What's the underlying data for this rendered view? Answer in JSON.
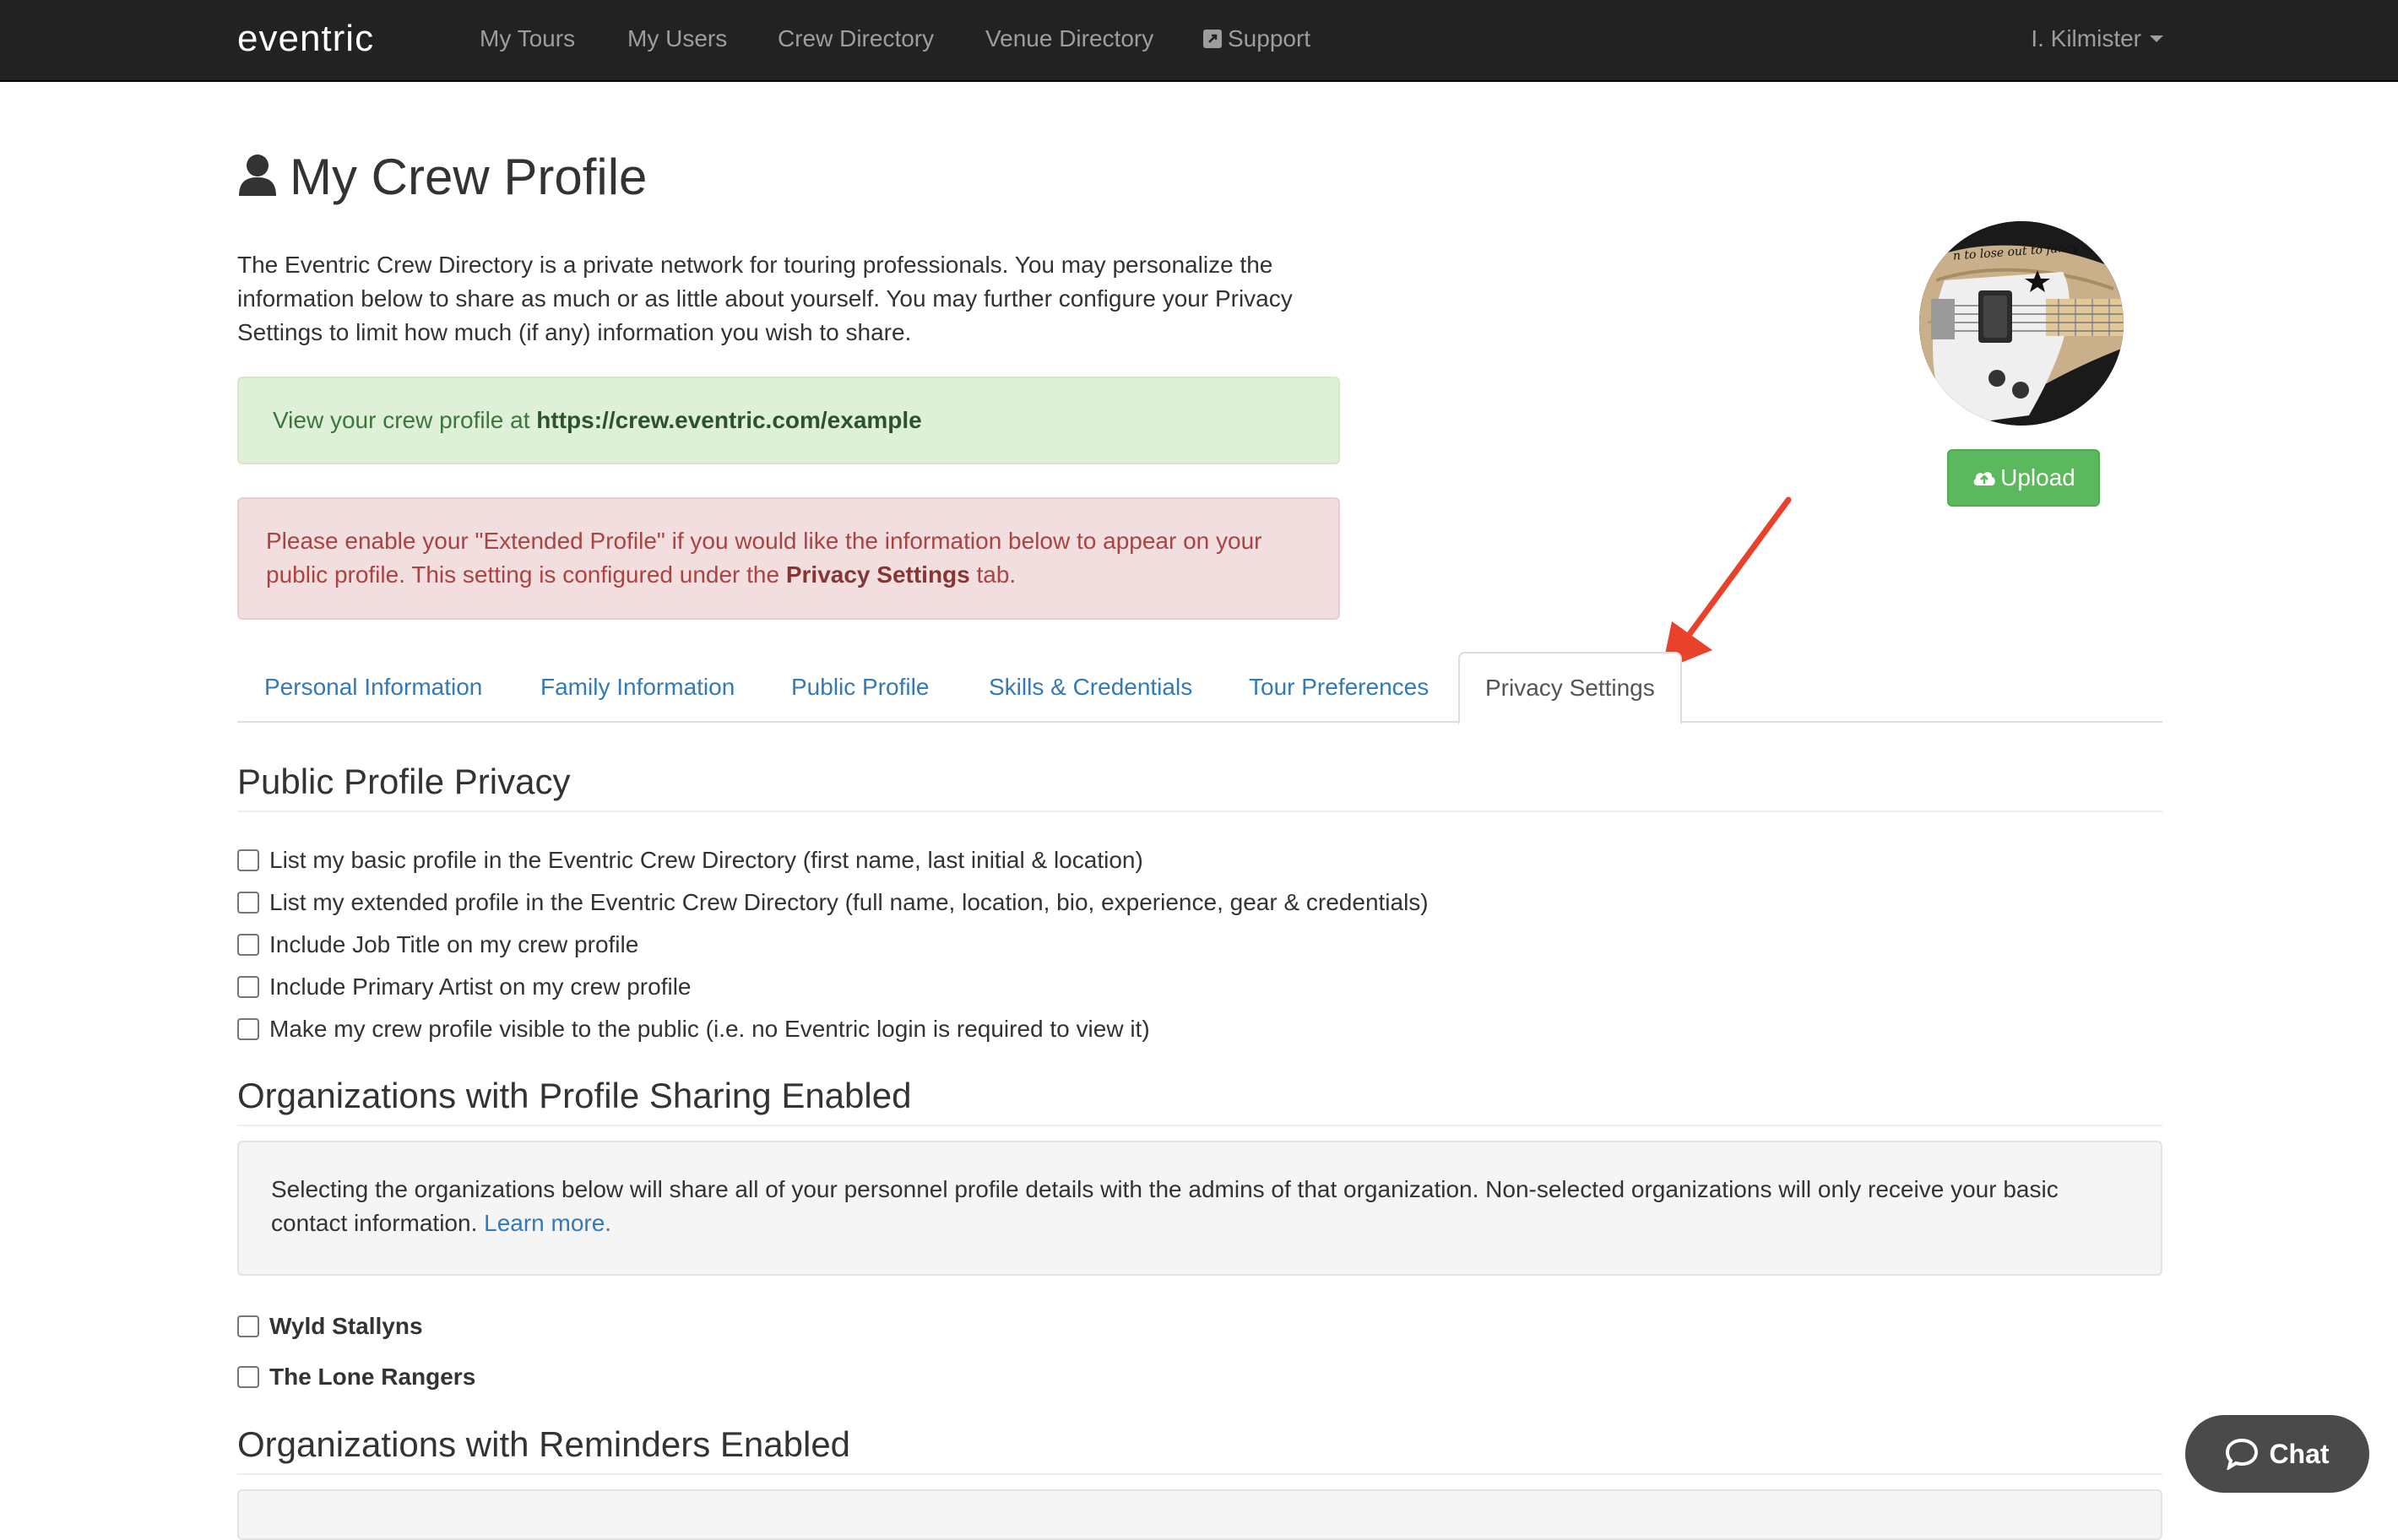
{
  "navbar": {
    "brand": "eventric",
    "links": [
      "My Tours",
      "My Users",
      "Crew Directory",
      "Venue Directory",
      "Support"
    ],
    "user": "I. Kilmister"
  },
  "page": {
    "title": "My Crew Profile",
    "intro": "The Eventric Crew Directory is a private network for touring professionals. You may personalize the information below to share as much or as little about yourself. You may further configure your Privacy Settings to limit how much (if any) information you wish to share."
  },
  "alerts": {
    "success_prefix": "View your crew profile at ",
    "success_link": "https://crew.eventric.com/example",
    "danger_text": "Please enable your \"Extended Profile\" if you would like the information below to appear on your public profile. This setting is configured under the ",
    "danger_bold": "Privacy Settings",
    "danger_suffix": " tab."
  },
  "avatar": {
    "image_text": "n to lose out to fancy",
    "upload_label": "Upload"
  },
  "tabs": [
    "Personal Information",
    "Family Information",
    "Public Profile",
    "Skills & Credentials",
    "Tour Preferences",
    "Privacy Settings"
  ],
  "active_tab": "Privacy Settings",
  "public_privacy": {
    "title": "Public Profile Privacy",
    "options": [
      "List my basic profile in the Eventric Crew Directory (first name, last initial & location)",
      "List my extended profile in the Eventric Crew Directory (full name, location, bio, experience, gear & credentials)",
      "Include Job Title on my crew profile",
      "Include Primary Artist on my crew profile",
      "Make my crew profile visible to the public (i.e. no Eventric login is required to view it)"
    ]
  },
  "sharing": {
    "title": "Organizations with Profile Sharing Enabled",
    "well_text": "Selecting the organizations below will share all of your personnel profile details with the admins of that organization. Non-selected organizations will only receive your basic contact information. ",
    "learn_more": "Learn more.",
    "orgs": [
      "Wyld Stallyns",
      "The Lone Rangers"
    ]
  },
  "reminders": {
    "title": "Organizations with Reminders Enabled"
  },
  "chat": {
    "label": "Chat"
  },
  "colors": {
    "navbar": "#222222",
    "link": "#337ab7",
    "success_bg": "#dff0d8",
    "danger_bg": "#f2dede",
    "upload_btn": "#5cb85c",
    "annotation_arrow": "#e8412c"
  }
}
